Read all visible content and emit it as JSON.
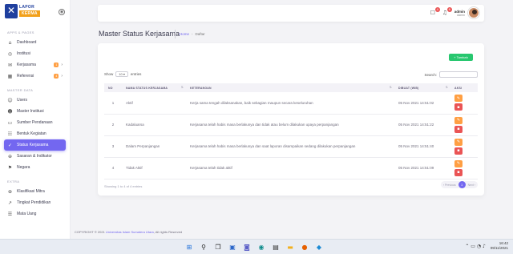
{
  "brand": {
    "line1": "LAPOR",
    "line2": "KERMA"
  },
  "sidebar": {
    "sections": [
      {
        "title": "APPS & PAGES",
        "items": [
          {
            "label": "Dashboard",
            "icon": "home-icon",
            "glyph": "⌂"
          },
          {
            "label": "Institusi",
            "icon": "location-icon",
            "glyph": "◎"
          },
          {
            "label": "Kerjasama",
            "icon": "mail-icon",
            "glyph": "✉",
            "badge": "1",
            "badge_color": "#ff9f43"
          },
          {
            "label": "Referensi",
            "icon": "calendar-icon",
            "glyph": "▦",
            "badge": "4",
            "badge_color": "#ff9f43"
          }
        ]
      },
      {
        "title": "MASTER DATA",
        "items": [
          {
            "label": "Users",
            "icon": "users-icon",
            "glyph": "☺"
          },
          {
            "label": "Master Institusi",
            "icon": "user-icon",
            "glyph": "☻"
          },
          {
            "label": "Sumber Pendanaan",
            "icon": "card-icon",
            "glyph": "▭"
          },
          {
            "label": "Bentuk Kegiatan",
            "icon": "list-icon",
            "glyph": "☷"
          },
          {
            "label": "Status Kerjasama",
            "icon": "user-check-icon",
            "glyph": "✓",
            "active": true
          },
          {
            "label": "Sasaran & Indikator",
            "icon": "globe-icon",
            "glyph": "⊕"
          },
          {
            "label": "Negara",
            "icon": "flag-icon",
            "glyph": "⚑"
          }
        ]
      },
      {
        "title": "EXTRA",
        "items": [
          {
            "label": "Klasifikasi Mitra",
            "icon": "globe-icon",
            "glyph": "⊕"
          },
          {
            "label": "Tingkat Pendidikan",
            "icon": "trending-icon",
            "glyph": "↗"
          },
          {
            "label": "Mata Uang",
            "icon": "list-icon",
            "glyph": "☰"
          }
        ]
      }
    ]
  },
  "topbar": {
    "notif_count_1": "4",
    "notif_count_2": "6",
    "user_name": "admin",
    "user_role": "Admin"
  },
  "page": {
    "title": "Master Status Kerjasama",
    "breadcrumb_home": "Home",
    "breadcrumb_current": "Daftar"
  },
  "card": {
    "add_label": "+ Tambah",
    "show_label": "Show",
    "show_value": "10",
    "entries_label": "entries",
    "search_label": "Search:",
    "columns": [
      "NO",
      "NAMA STATUS KERJASAMA",
      "KETERANGAN",
      "DIBUAT (WIB)",
      "AKSI"
    ],
    "rows": [
      {
        "no": "1",
        "name": "Aktif",
        "ket": "Kerja sama tengah dilaksanakan, baik sebagian maupun secara keseluruhan",
        "date": "05 Nov 2021 14:51:02"
      },
      {
        "no": "2",
        "name": "Kadaluarsa",
        "ket": "Kerjasama telah habis masa berlakunya dan tidak atau belum dilakukan upaya perpanjangan",
        "date": "05 Nov 2021 14:51:22"
      },
      {
        "no": "3",
        "name": "Dalam Perpanjangan",
        "ket": "Kerjasama telah habis masa berlakunya dan saat laporan disampaikan sedang dilakukan perpanjangan",
        "date": "05 Nov 2021 14:51:40"
      },
      {
        "no": "4",
        "name": "Tidak Aktif",
        "ket": "Kerjasama telah tidak aktif",
        "date": "05 Nov 2021 14:51:09"
      }
    ],
    "info": "Showing 1 to 4 of 4 entries",
    "prev_label": "‹ Previous",
    "page": "1",
    "next_label": "Next ›"
  },
  "footer": {
    "prefix": "COPYRIGHT © 2021 ",
    "link": "Universitas Islam Sumatera Utara",
    "suffix": ", All rights Reserved"
  },
  "taskbar": {
    "time": "16:42",
    "date": "09/11/2021",
    "apps": [
      {
        "name": "windows-start-icon",
        "glyph": "⊞",
        "color": "#1e6fd9"
      },
      {
        "name": "search-icon",
        "glyph": "⚲",
        "color": "#222"
      },
      {
        "name": "task-view-icon",
        "glyph": "❐",
        "color": "#222"
      },
      {
        "name": "widgets-icon",
        "glyph": "▣",
        "color": "#2b66c9"
      },
      {
        "name": "chat-icon",
        "glyph": "◙",
        "color": "#5b5fc7"
      },
      {
        "name": "edge-icon",
        "glyph": "◉",
        "color": "#0b8a8a"
      },
      {
        "name": "store-icon",
        "glyph": "▤",
        "color": "#333"
      },
      {
        "name": "explorer-icon",
        "glyph": "▬",
        "color": "#f2b01e"
      },
      {
        "name": "firefox-icon",
        "glyph": "●",
        "color": "#e66000"
      },
      {
        "name": "vscode-icon",
        "glyph": "◆",
        "color": "#1c8ad4"
      }
    ]
  }
}
